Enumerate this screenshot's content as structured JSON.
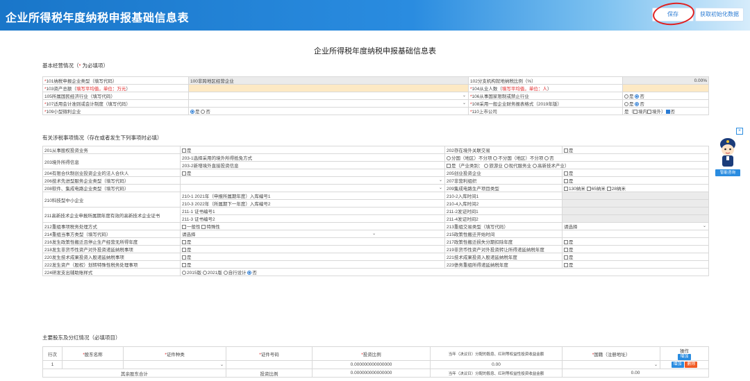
{
  "header": {
    "title": "企业所得税年度纳税申报基础信息表",
    "save_label": "保存",
    "reset_label": "获取初始化数据"
  },
  "page_title": "企业所得税年度纳税申报基础信息表",
  "basic": {
    "section_title_a": "基本经营情况（",
    "section_title_req": "*",
    "section_title_b": " 为必填项）",
    "rows": [
      {
        "l": "101纳税申报企业类型（填写代码）",
        "v": "100非跨地区经营企业",
        "r": "102分支机构就地纳税比例（%）",
        "rv": "0.00%"
      },
      {
        "l": "103资产总额（",
        "lred": "填写平均值，单位：万元",
        "lend": "）",
        "r": "104从业人数（",
        "rred": "填写平均值，单位：人",
        "rend": "）"
      },
      {
        "l": "105所属国民经济行业（填写代码）",
        "r": "106从事国家限制或禁止行业",
        "r_opt1": "是",
        "r_opt2": "否"
      },
      {
        "l": "107适用会计准则或会计制度（填写代码）",
        "r": "108采用一般企业财务报表格式（2019年版）",
        "r_opt1": "是",
        "r_opt2": "否"
      },
      {
        "l": "109小型微利企业",
        "v_opt1": "是",
        "v_opt2": "否",
        "r": "110上市公司",
        "rv_a": "是（",
        "rv_b": "境内",
        "rv_c": "境外）",
        "rv_d": "否"
      }
    ]
  },
  "tax": {
    "section_title": "有关涉税事项情况（存在或者发生下列事项时必填）",
    "r201": "201从事股权投资业务",
    "yes": "是",
    "r202": "202存在境外关联交易",
    "r203": "203境外所得信息",
    "r203_1": "203-1选择采用的境外所得抵免方式",
    "r203_1v_a": "分国（地区）不分项",
    "r203_1v_b": "不分国（地区）不分项",
    "r203_1v_c": "否",
    "r203_2": "203-2新增境外直接投资信息",
    "r203_2v_a": "是（产业类别：",
    "r203_2v_b": "旅游业",
    "r203_2v_c": "现代服务业",
    "r203_2v_d": "高新技术产业）",
    "r204": "204有限合伙制创业投资企业的法人合伙人",
    "r205": "205创业投资企业",
    "r206": "206技术先进型服务企业类型（填写代码）",
    "r207": "207非营利组织",
    "r208": "208软件、集成电路企业类型（填写代码）",
    "r209": "209集成电路生产项目类型",
    "r209v_a": "130纳米",
    "r209v_b": "65纳米",
    "r209v_c": "28纳米",
    "r210": "210科技型中小企业",
    "r210_1": "210-1 2021年（申报所属期年度）入库编号1",
    "r210_2": "210-2入库时间1",
    "r210_3": "210-3 2022年（所属期下一年度）入库编号2",
    "r210_4": "210-4入库时间2",
    "r211": "211高新技术企业申报所属期年度有效的高新技术企业证书",
    "r211_1": "211-1 证书编号1",
    "r211_2": "211-2发证时间1",
    "r211_3": "211-3 证书编号2",
    "r211_4": "211-4发证时间2",
    "r212": "212重组事项税务处理方式",
    "r212v_a": "一般性",
    "r212v_b": "特殊性",
    "r213": "213重组交易类型（填写代码）",
    "r213v": "请选择",
    "r214": "214重组当事方类型（填写代码）",
    "r214v": "请选择",
    "r215": "215政策性搬迁开始时间",
    "r216": "216发生政策性搬迁且停止生产经营无所得年度",
    "r217": "217政策性搬迁损失分期扣除年度",
    "r218": "218发生非货币性资产对外投资递延纳税事项",
    "r219": "219非货币性资产对外投资转让所得递延纳税年度",
    "r220": "220发生技术成果投资入股递延纳税事项",
    "r221": "221技术成果投资入股递延纳税年度",
    "r222": "222发生资产（股权）划转特殊性税务处理事项",
    "r223": "223债务重组所得递延纳税年度",
    "r224": "224研发支出辅助账样式",
    "r224v_a": "2015版",
    "r224v_b": "2021版",
    "r224v_c": "自行设计",
    "r224v_d": "否"
  },
  "shareholders": {
    "section_title": "主要股东及分红情况（必填项目）",
    "headers": {
      "idx": "行次",
      "name": "股东名称",
      "cert_type": "证件种类",
      "cert_no": "证件号码",
      "ratio": "投资比例",
      "dividend": "当年（决议日）分配的股息、红利等权益性投资收益金额",
      "nation": "国籍（注册地址）",
      "op": "操作",
      "req": "*"
    },
    "add_label": "增加",
    "delete_label": "删除",
    "row": {
      "idx": "1",
      "ratio": "0.000000000000000",
      "dividend": "0.00"
    },
    "footer": {
      "label": "其余股东合计",
      "ratio_label": "投资比例",
      "ratio": "0.000000000000000",
      "dividend_label": "当年（决议日）分配的股息、红利等权益性投资收益金额",
      "dividend": "0.00"
    }
  },
  "assistant": {
    "label": "智能咨询",
    "close": "×"
  }
}
